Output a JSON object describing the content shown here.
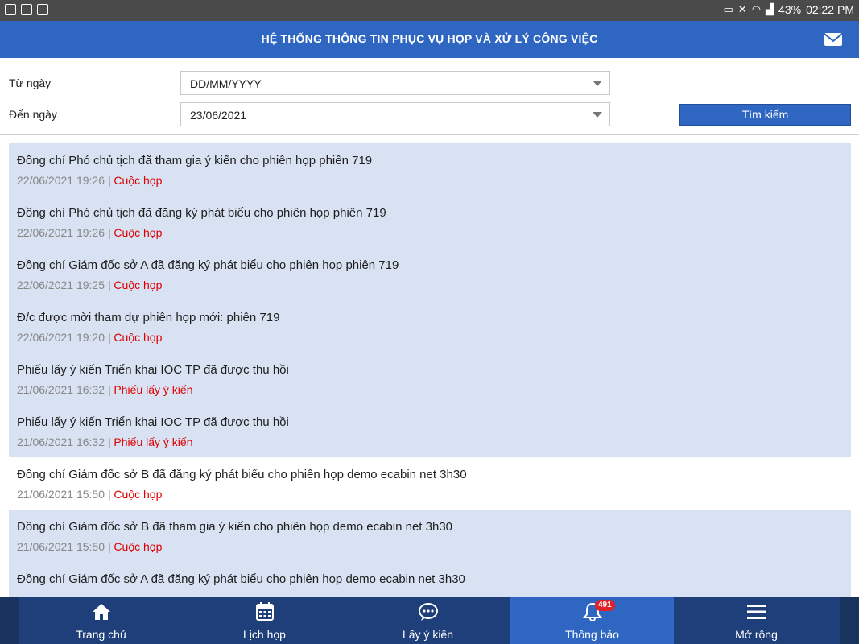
{
  "status_bar": {
    "battery": "43%",
    "time": "02:22 PM"
  },
  "app_bar": {
    "title": "HỆ THỐNG THÔNG TIN PHỤC VỤ HỌP VÀ XỬ LÝ CÔNG VIỆC",
    "mail_icon": "mail-icon"
  },
  "filters": {
    "from_label": "Từ ngày",
    "from_value": "DD/MM/YYYY",
    "to_label": "Đến ngày",
    "to_value": "23/06/2021",
    "search_label": "Tìm kiếm"
  },
  "notifications": [
    {
      "message": "Đồng chí Phó chủ tịch đã tham gia ý kiến cho phiên họp phiên 719",
      "time": "22/06/2021 19:26",
      "category": "Cuộc họp",
      "unread": true
    },
    {
      "message": "Đồng chí Phó chủ tịch đã đăng ký phát biểu cho phiên họp phiên 719",
      "time": "22/06/2021 19:26",
      "category": "Cuộc họp",
      "unread": true
    },
    {
      "message": "Đồng chí Giám đốc sở A đã đăng ký phát biểu cho phiên họp phiên 719",
      "time": "22/06/2021 19:25",
      "category": "Cuộc họp",
      "unread": true
    },
    {
      "message": "Đ/c được mời tham dự phiên họp mới: phiên 719",
      "time": "22/06/2021 19:20",
      "category": "Cuộc họp",
      "unread": true
    },
    {
      "message": "Phiếu lấy ý kiến Triển khai IOC TP đã được thu hồi",
      "time": "21/06/2021 16:32",
      "category": "Phiếu lấy ý kiến",
      "unread": true
    },
    {
      "message": "Phiếu lấy ý kiến Triển khai IOC TP đã được thu hồi",
      "time": "21/06/2021 16:32",
      "category": "Phiếu lấy ý kiến",
      "unread": true
    },
    {
      "message": "Đồng chí Giám đốc sở B đã đăng ký phát biểu cho phiên họp demo ecabin net 3h30",
      "time": "21/06/2021 15:50",
      "category": "Cuộc họp",
      "unread": false
    },
    {
      "message": "Đồng chí Giám đốc sở B đã tham gia ý kiến cho phiên họp demo ecabin net 3h30",
      "time": "21/06/2021 15:50",
      "category": "Cuộc họp",
      "unread": true
    },
    {
      "message": "Đồng chí Giám đốc sở A đã đăng ký phát biểu cho phiên họp demo ecabin net 3h30",
      "time": "",
      "category": "",
      "unread": true
    }
  ],
  "bottom_nav": {
    "tabs": [
      {
        "label": "Trang chủ",
        "icon": "home-icon"
      },
      {
        "label": "Lịch họp",
        "icon": "calendar-icon"
      },
      {
        "label": "Lấy ý kiến",
        "icon": "chat-icon"
      },
      {
        "label": "Thông báo",
        "icon": "bell-icon",
        "active": true
      },
      {
        "label": "Mở rộng",
        "icon": "menu-icon"
      }
    ],
    "badge": "491"
  },
  "colors": {
    "primary": "#2e66c2",
    "nav_bg": "#1f3f7a",
    "unread_bg": "#d8e2f2",
    "category_red": "#e00000"
  }
}
